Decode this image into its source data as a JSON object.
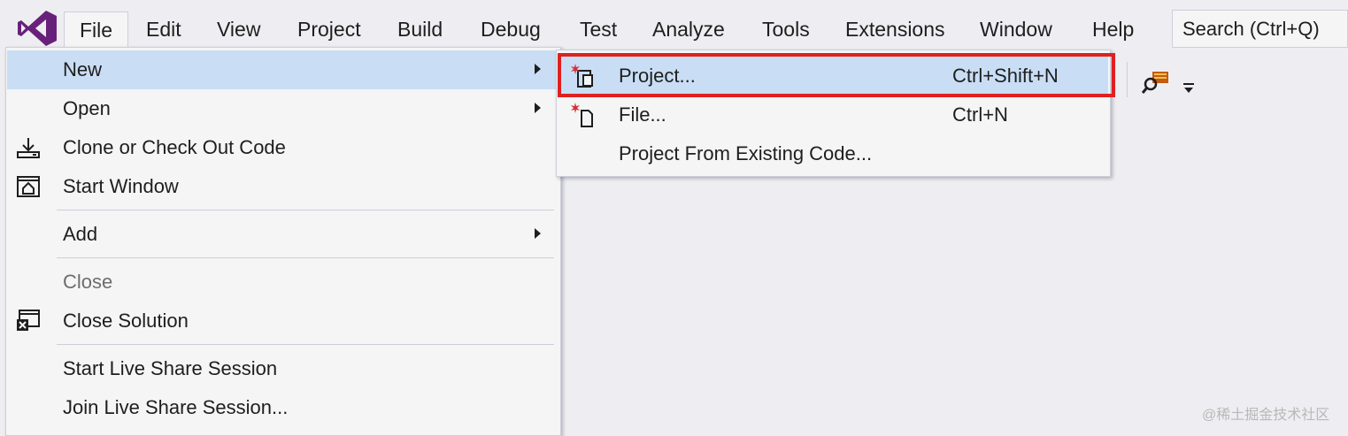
{
  "menubar": {
    "items": [
      {
        "label": "File"
      },
      {
        "label": "Edit"
      },
      {
        "label": "View"
      },
      {
        "label": "Project"
      },
      {
        "label": "Build"
      },
      {
        "label": "Debug"
      },
      {
        "label": "Test"
      },
      {
        "label": "Analyze"
      },
      {
        "label": "Tools"
      },
      {
        "label": "Extensions"
      },
      {
        "label": "Window"
      },
      {
        "label": "Help"
      }
    ],
    "search_placeholder": "Search (Ctrl+Q)"
  },
  "file_menu": {
    "new": {
      "label": "New",
      "icon": "none"
    },
    "open": {
      "label": "Open",
      "icon": "none"
    },
    "clone": {
      "label": "Clone or Check Out Code",
      "icon": "download-icon"
    },
    "start_window": {
      "label": "Start Window",
      "icon": "home-window-icon"
    },
    "add": {
      "label": "Add",
      "icon": "none"
    },
    "close": {
      "label": "Close",
      "icon": "none"
    },
    "close_solution": {
      "label": "Close Solution",
      "icon": "close-solution-icon"
    },
    "start_live_share": {
      "label": "Start Live Share Session",
      "icon": "none"
    },
    "join_live_share": {
      "label": "Join Live Share Session...",
      "icon": "none"
    }
  },
  "new_submenu": {
    "project": {
      "label": "Project...",
      "shortcut": "Ctrl+Shift+N",
      "icon": "new-project-icon"
    },
    "file": {
      "label": "File...",
      "shortcut": "Ctrl+N",
      "icon": "new-file-icon"
    },
    "from_existing": {
      "label": "Project From Existing Code..."
    }
  },
  "colors": {
    "menu_bg": "#f5f5f5",
    "highlight": "#c9def5",
    "callout_border": "#e02020",
    "logo_purple": "#68217a",
    "new_star_red": "#d13438"
  },
  "watermark": "@稀土掘金技术社区"
}
